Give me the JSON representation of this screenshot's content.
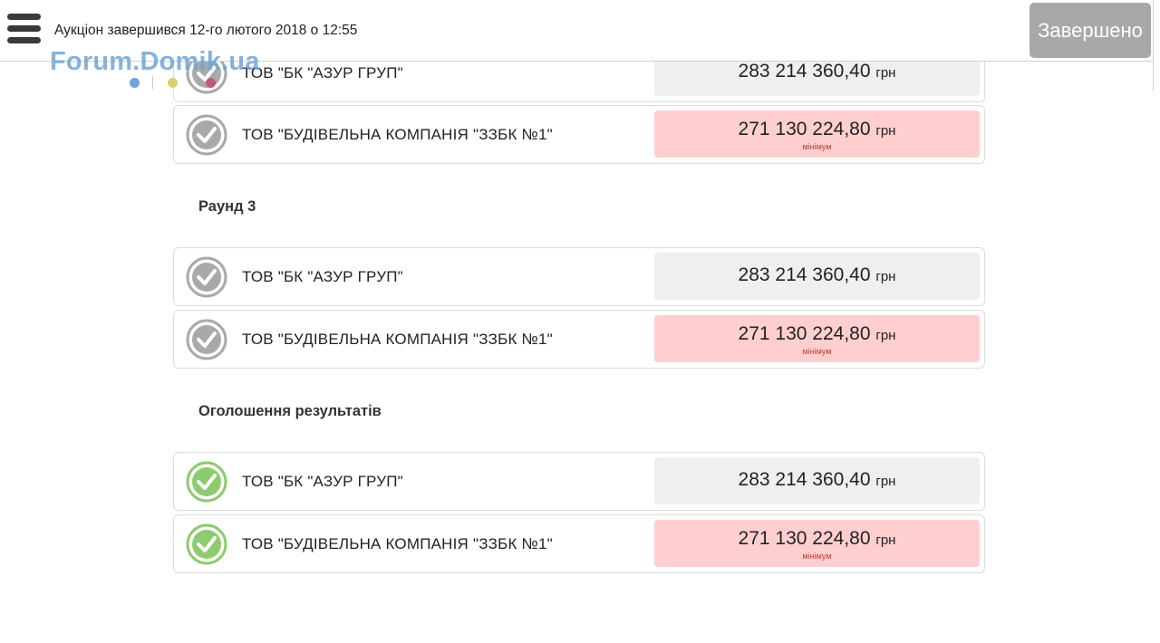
{
  "header": {
    "status_text": "Аукціон завершився 12-го лютого 2018 о 12:55",
    "status_button": "Завершено"
  },
  "watermark": {
    "text": "Forum.Domik.ua"
  },
  "currency": "грн",
  "min_label": "мінімум",
  "round2_partial": [
    {
      "bidder": "ТОВ \"БК \"АЗУР ГРУП\"",
      "amount": "283 214 360,40",
      "is_minimum": false,
      "status": "grey-check"
    },
    {
      "bidder": "ТОВ \"БУДІВЕЛЬНА КОМПАНІЯ \"ЗЗБК №1\"",
      "amount": "271 130 224,80",
      "is_minimum": true,
      "status": "grey-check"
    }
  ],
  "round3": {
    "title": "Раунд 3",
    "rows": [
      {
        "bidder": "ТОВ \"БК \"АЗУР ГРУП\"",
        "amount": "283 214 360,40",
        "is_minimum": false,
        "status": "grey-check"
      },
      {
        "bidder": "ТОВ \"БУДІВЕЛЬНА КОМПАНІЯ \"ЗЗБК №1\"",
        "amount": "271 130 224,80",
        "is_minimum": true,
        "status": "grey-check"
      }
    ]
  },
  "results": {
    "title": "Оголошення результатів",
    "rows": [
      {
        "bidder": "ТОВ \"БК \"АЗУР ГРУП\"",
        "amount": "283 214 360,40",
        "is_minimum": false,
        "status": "green-check"
      },
      {
        "bidder": "ТОВ \"БУДІВЕЛЬНА КОМПАНІЯ \"ЗЗБК №1\"",
        "amount": "271 130 224,80",
        "is_minimum": true,
        "status": "green-check"
      }
    ]
  },
  "colors": {
    "grey_check": "#a9a9a9",
    "green_check": "#8ccb6e",
    "min_bg": "#ffcfcf",
    "normal_bg": "#efefef",
    "button_bg": "#a8a8a8"
  }
}
